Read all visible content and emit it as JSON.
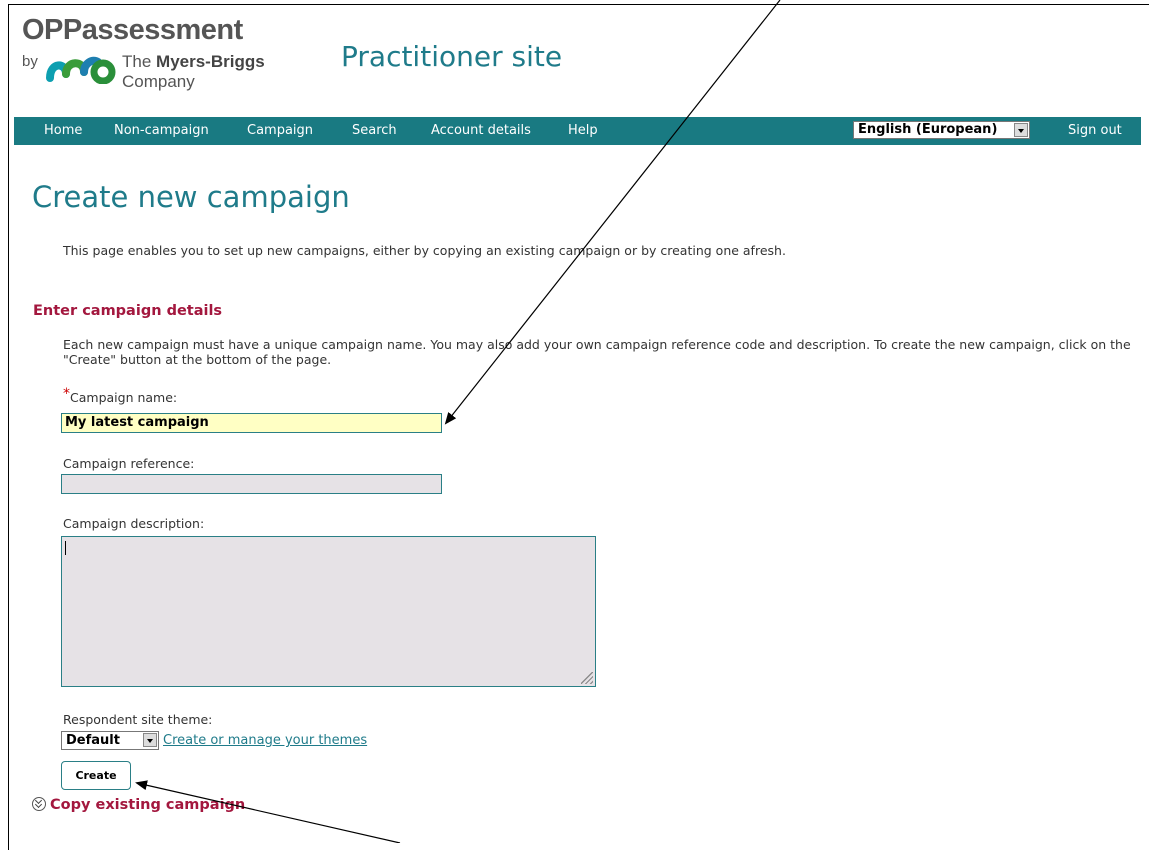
{
  "header": {
    "top_partial_text": "                                                           ",
    "logo_title": "OPPassessment",
    "logo_by": "by",
    "company_the": "The ",
    "company_name": "Myers-Briggs",
    "company_suffix": "Company",
    "site_title": "Practitioner site"
  },
  "nav": {
    "items": [
      "Home",
      "Non-campaign",
      "Campaign",
      "Search",
      "Account details",
      "Help"
    ],
    "language": "English (European)",
    "sign_out": "Sign out"
  },
  "page": {
    "title": "Create new campaign",
    "intro": "This page enables you to set up new campaigns, either by copying an existing campaign or by creating one afresh."
  },
  "form": {
    "section_title": "Enter campaign details",
    "section_desc": "Each new campaign must have a unique campaign name. You may also add your own campaign reference code and description. To create the new campaign, click on the \"Create\" button at the bottom of the page.",
    "required_marker": "*",
    "name_label": "Campaign name:",
    "name_value": "My latest campaign",
    "reference_label": "Campaign reference:",
    "reference_value": "",
    "description_label": "Campaign description:",
    "description_value": "",
    "theme_label": "Respondent site theme:",
    "theme_value": "Default",
    "theme_link": "Create or manage your themes",
    "create_button": "Create"
  },
  "copy_section": {
    "title": "Copy existing campaign"
  },
  "colors": {
    "nav_bg": "#197a82",
    "accent_teal": "#1f7b8a",
    "heading_red": "#a3173e",
    "active_input": "#ffffc4",
    "inactive_input": "#e6e2e6"
  }
}
